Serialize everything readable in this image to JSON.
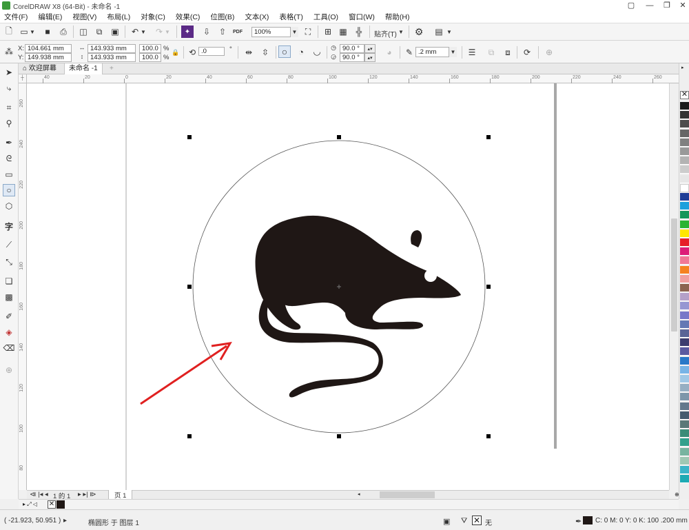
{
  "titlebar": {
    "title": "CorelDRAW X8 (64-Bit) - 未命名 -1"
  },
  "menu": [
    "文件(F)",
    "编辑(E)",
    "视图(V)",
    "布局(L)",
    "对象(C)",
    "效果(C)",
    "位图(B)",
    "文本(X)",
    "表格(T)",
    "工具(O)",
    "窗口(W)",
    "帮助(H)"
  ],
  "toolbar": {
    "zoom": "100%",
    "snap_label": "贴齐(T)",
    "pdf_label": "PDF"
  },
  "propbar": {
    "x_label": "X:",
    "x_value": "104.661 mm",
    "y_label": "Y:",
    "y_value": "149.938 mm",
    "width_value": "143.933 mm",
    "height_value": "143.933 mm",
    "scale_w": "100.0",
    "scale_h": "100.0",
    "percent": "%",
    "rotation": ".0",
    "start_angle": "90.0 °",
    "end_angle": "90.0 °",
    "outline_width": ".2 mm"
  },
  "tabs": {
    "welcome": "欢迎屏幕",
    "doc": "未命名 -1"
  },
  "rulers": {
    "h_ticks": [
      "40",
      "20",
      "0",
      "20",
      "40",
      "60",
      "80",
      "100",
      "120",
      "140",
      "160",
      "180",
      "200",
      "220",
      "240",
      "260"
    ],
    "v_ticks": [
      "260",
      "240",
      "220",
      "200",
      "180",
      "160",
      "140",
      "120",
      "100",
      "80"
    ]
  },
  "pagebar": {
    "page_count": "1 的 1",
    "page_tab": "页 1"
  },
  "status": {
    "coords": "( -21.923, 50.951 )",
    "object_info": "椭圆形 于 图层 1",
    "fill_none": "无",
    "outline_info": "C: 0 M: 0 Y: 0 K: 100  .200 mm"
  },
  "palette_colors": [
    "#1a1a1a",
    "#333333",
    "#4d4d4d",
    "#666666",
    "#808080",
    "#999999",
    "#b3b3b3",
    "#cccccc",
    "#e6e6e6",
    "#ffffff",
    "#1e3c96",
    "#1ea0dc",
    "#14965a",
    "#28b432",
    "#ffe600",
    "#e61e28",
    "#dc1e78",
    "#f07896",
    "#f58220",
    "#f0a0a0",
    "#8c6450",
    "#b4a0c8",
    "#9696d2",
    "#7878c8",
    "#6478b4",
    "#5a6496",
    "#3c3c6e",
    "#5a5aa0",
    "#2878c8",
    "#78b4e6",
    "#a0c8e6",
    "#96afc3",
    "#7d96aa",
    "#64788c",
    "#465a6e",
    "#5a7878",
    "#3c8c78",
    "#32a08c",
    "#78b4a0",
    "#a0c8b4",
    "#3cb4c8",
    "#1eaab4"
  ],
  "colors": {
    "accent_arrow": "#e02020",
    "mouse_fill": "#1f1715",
    "selection_handle": "#000000"
  }
}
